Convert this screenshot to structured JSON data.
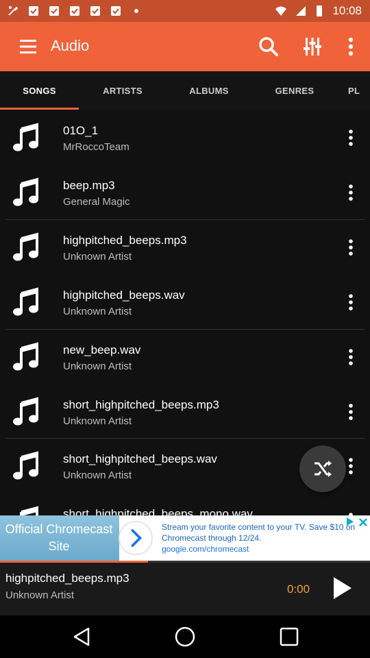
{
  "status_bar": {
    "time": "10:08"
  },
  "app_bar": {
    "title": "Audio",
    "menu_icon": "hamburger-menu-icon",
    "search_icon": "search-icon",
    "equalizer_icon": "equalizer-icon",
    "overflow_icon": "more-vert-icon"
  },
  "tabs": [
    {
      "label": "SONGS",
      "active": true
    },
    {
      "label": "ARTISTS",
      "active": false
    },
    {
      "label": "ALBUMS",
      "active": false
    },
    {
      "label": "GENRES",
      "active": false
    },
    {
      "label": "PL",
      "active": false
    }
  ],
  "songs": [
    {
      "title": "01O_1",
      "artist": "MrRoccoTeam"
    },
    {
      "title": "beep.mp3",
      "artist": "General Magic"
    },
    {
      "title": "highpitched_beeps.mp3",
      "artist": "Unknown Artist"
    },
    {
      "title": "highpitched_beeps.wav",
      "artist": "Unknown Artist"
    },
    {
      "title": "new_beep.wav",
      "artist": "Unknown Artist"
    },
    {
      "title": "short_highpitched_beeps.mp3",
      "artist": "Unknown Artist"
    },
    {
      "title": "short_highpitched_beeps.wav",
      "artist": "Unknown Artist"
    },
    {
      "title": "short_highpitched_beeps_mono.wav",
      "artist": ""
    }
  ],
  "ad": {
    "headline": "Official Chromecast Site",
    "body": "Stream your favorite content to your TV. Save $10 on Chromecast through 12/24.",
    "url": "google.com/chromecast"
  },
  "player": {
    "title": "highpitched_beeps.mp3",
    "artist": "Unknown Artist",
    "time": "0:00",
    "progress": 0.4
  },
  "colors": {
    "accent": "#f0623a",
    "status_bar": "#c44f2c",
    "time_text": "#f0a033"
  }
}
